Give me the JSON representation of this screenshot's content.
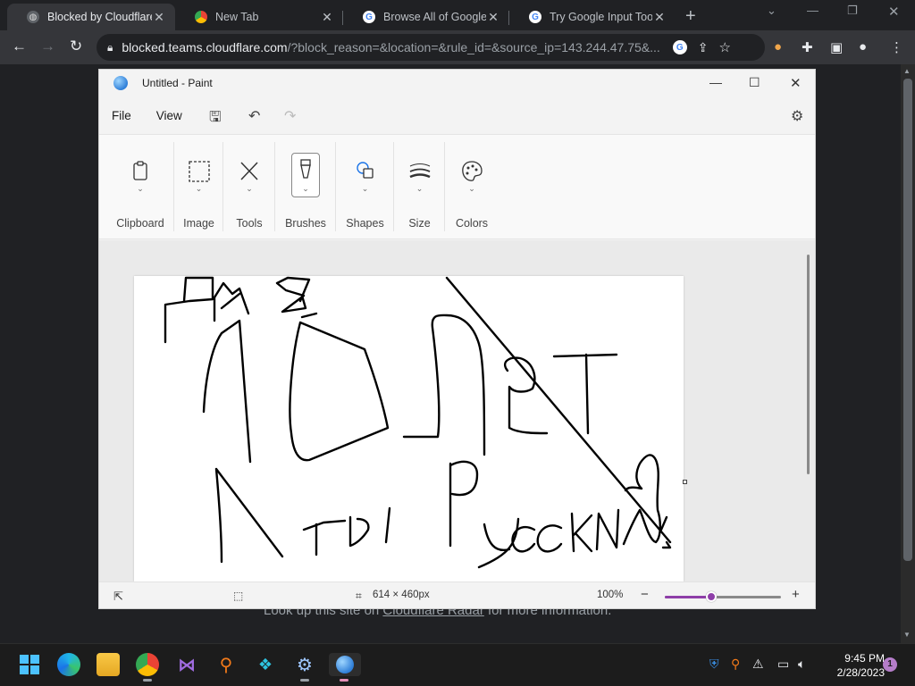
{
  "browser": {
    "tabs": [
      {
        "title": "Blocked by Cloudflare Gateway",
        "favicon": "globe-icon",
        "active": true
      },
      {
        "title": "New Tab",
        "favicon": "chrome-icon",
        "active": false
      },
      {
        "title": "Browse All of Google's Products",
        "favicon": "google-icon",
        "active": false
      },
      {
        "title": "Try Google Input Tools online",
        "favicon": "google-icon",
        "active": false
      }
    ],
    "new_tab_glyph": "+",
    "url_host": "blocked.teams.cloudflare.com",
    "url_rest": "/?block_reason=&location=&rule_id=&source_ip=143.244.47.75&...",
    "page_text_prefix": "Look up this site on ",
    "page_link": "Cloudflare Radar",
    "page_text_suffix": " for more information."
  },
  "paint": {
    "window_title": "Untitled - Paint",
    "menu": {
      "file": "File",
      "view": "View"
    },
    "ribbon_groups": [
      "Clipboard",
      "Image",
      "Tools",
      "Brushes",
      "Shapes",
      "Size",
      "Colors"
    ],
    "status": {
      "canvas_size": "614 × 460px",
      "zoom": "100%",
      "zoom_fraction": 0.4
    },
    "drawing_text": "ТЫ РУССКИЙ"
  },
  "taskbar": {
    "apps": [
      "start-icon",
      "edge-icon",
      "file-explorer-icon",
      "chrome-icon",
      "visual-studio-icon",
      "search-magnifier-icon",
      "azure-data-studio-icon",
      "settings-icon",
      "paint-icon"
    ],
    "time": "9:45 PM",
    "date": "2/28/2023",
    "notification_count": "1"
  },
  "colors": {
    "chrome_dark": "#202124",
    "chrome_toolbar": "#35363a",
    "paint_accent": "#8e3ea8",
    "taskbar": "#1c1c1c"
  }
}
